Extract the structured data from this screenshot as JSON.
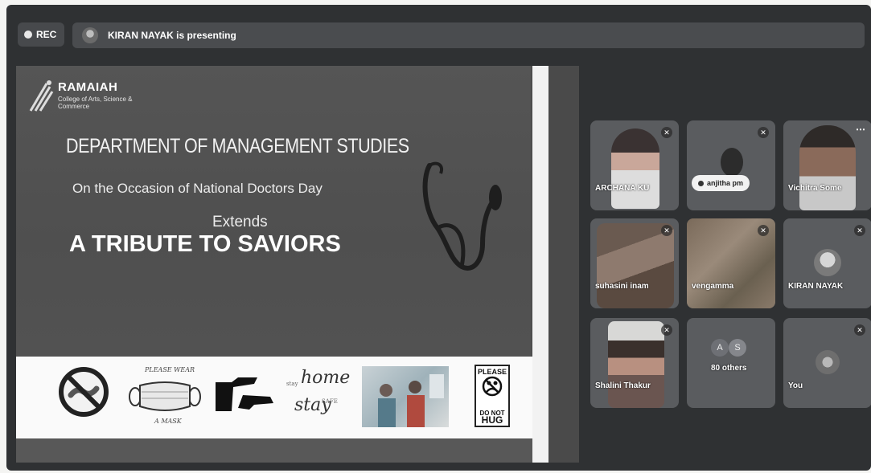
{
  "top_bar": {
    "rec_label": "REC",
    "presenting_text": "KIRAN NAYAK is presenting"
  },
  "slide": {
    "brand": "RAMAIAH",
    "brand_sub": "College of Arts, Science & Commerce",
    "department": "DEPARTMENT OF MANAGEMENT STUDIES",
    "occasion": "On the Occasion of National Doctors Day",
    "extends": "Extends",
    "tribute": "A TRIBUTE TO SAVIORS",
    "mask_top": "PLEASE WEAR",
    "mask_bottom": "A MASK",
    "stay_home_1": "home",
    "stay_home_2": "stay",
    "stay_small_1": "stay",
    "stay_small_2": "SAFE",
    "sign_top": "PLEASE",
    "sign_mid": "DO NOT",
    "sign_bottom": "HUG"
  },
  "participants": [
    {
      "name": "ARCHANA KU",
      "muted": true
    },
    {
      "name": "anjitha pm",
      "muted": true,
      "chip": true
    },
    {
      "name": "Vichitra Some",
      "more": true
    },
    {
      "name": "suhasini inam",
      "muted": true
    },
    {
      "name": "vengamma",
      "muted": true
    },
    {
      "name": "KIRAN NAYAK",
      "muted": true
    },
    {
      "name": "Shalini Thakur",
      "muted": true
    },
    {
      "name": "80 others",
      "initials": [
        "A",
        "S"
      ]
    },
    {
      "name": "You",
      "muted": true
    }
  ],
  "icons": {
    "mic_off": "🎙",
    "more": "⋯"
  }
}
